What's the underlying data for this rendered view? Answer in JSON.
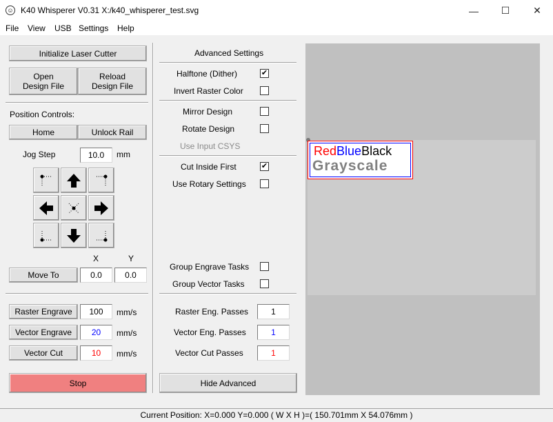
{
  "window": {
    "title": "K40 Whisperer V0.31   X:/k40_whisperer_test.svg",
    "controls": {
      "minimize": "—",
      "maximize": "☐",
      "close": "✕"
    }
  },
  "menu": [
    "File",
    "View",
    "USB",
    "Settings",
    "Help"
  ],
  "left": {
    "initialize_label": "Initialize Laser Cutter",
    "open_label": "Open\nDesign File",
    "reload_label": "Reload\nDesign File",
    "position_controls_label": "Position Controls:",
    "home_label": "Home",
    "unlock_rail_label": "Unlock Rail",
    "jog_step_label": "Jog Step",
    "jog_step_value": "10.0",
    "jog_step_unit": "mm",
    "x_header": "X",
    "y_header": "Y",
    "move_to_label": "Move To",
    "move_x_value": "0.0",
    "move_y_value": "0.0",
    "raster_engrave_label": "Raster Engrave",
    "raster_speed": "100",
    "vector_engrave_label": "Vector Engrave",
    "vector_engrave_speed": "20",
    "vector_cut_label": "Vector Cut",
    "vector_cut_speed": "10",
    "speed_unit": "mm/s",
    "stop_label": "Stop"
  },
  "advanced": {
    "heading": "Advanced Settings",
    "halftone_label": "Halftone (Dither)",
    "halftone_checked": true,
    "invert_raster_label": "Invert Raster Color",
    "invert_raster_checked": false,
    "mirror_label": "Mirror Design",
    "mirror_checked": false,
    "rotate_label": "Rotate Design",
    "rotate_checked": false,
    "input_csys_label": "Use Input CSYS",
    "cut_inside_label": "Cut Inside First",
    "cut_inside_checked": true,
    "rotary_label": "Use Rotary Settings",
    "rotary_checked": false,
    "group_engrave_label": "Group Engrave Tasks",
    "group_engrave_checked": false,
    "group_vector_label": "Group Vector Tasks",
    "group_vector_checked": false,
    "raster_passes_label": "Raster Eng. Passes",
    "raster_passes_value": "1",
    "vector_eng_passes_label": "Vector Eng. Passes",
    "vector_eng_passes_value": "1",
    "vector_cut_passes_label": "Vector Cut Passes",
    "vector_cut_passes_value": "1",
    "hide_advanced_label": "Hide Advanced"
  },
  "canvas": {
    "design_red": "Red",
    "design_blue": "Blue",
    "design_black": "Black",
    "design_gray": "Grayscale"
  },
  "status": {
    "text": "Current Position: X=0.000 Y=0.000    ( W X H )=( 150.701mm X 54.076mm )"
  },
  "colors": {
    "stop_button": "#f08080",
    "engrave_blue": "#0000ff",
    "cut_red": "#ff0000",
    "canvas_bg": "#c0c0c0",
    "work_area": "#cccccc"
  },
  "icons": {
    "jog_up_left": "corner-up-left-icon",
    "jog_up": "arrow-up-icon",
    "jog_up_right": "corner-up-right-icon",
    "jog_left": "arrow-left-icon",
    "jog_center": "center-icon",
    "jog_right": "arrow-right-icon",
    "jog_down_left": "corner-down-left-icon",
    "jog_down": "arrow-down-icon",
    "jog_down_right": "corner-down-right-icon"
  }
}
